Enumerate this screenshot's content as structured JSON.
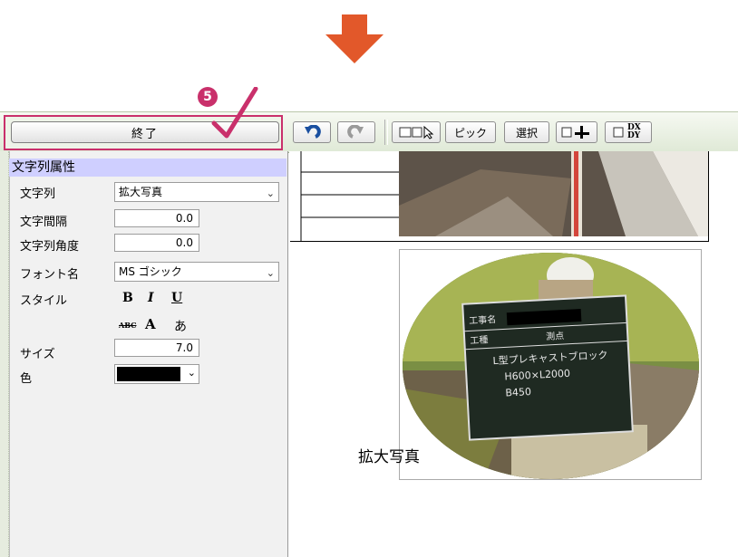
{
  "step": {
    "number": "5"
  },
  "end_button": {
    "label": "終了"
  },
  "toolbar": {
    "pick_label": "ピック",
    "select_label": "選択",
    "dxdy_label": "DX DY"
  },
  "panel": {
    "header": "文字列属性",
    "rows": [
      {
        "label": "文字列",
        "value": "拡大写真"
      },
      {
        "label": "文字間隔",
        "value": "0.0"
      },
      {
        "label": "文字列角度",
        "value": "0.0"
      },
      {
        "label": "フォント名",
        "value": "MS ゴシック"
      },
      {
        "label": "スタイル"
      },
      {
        "label": "サイズ",
        "value": "7.0"
      },
      {
        "label": "色"
      }
    ],
    "style_buttons": {
      "bold": "B",
      "italic": "I",
      "underline": "U",
      "strike": "ABC",
      "a_plus": "A",
      "hiragana": "あ"
    }
  },
  "canvas": {
    "caption": "拡大写真"
  },
  "colors": {
    "accent": "#c9306b",
    "arrow": "#e2582a",
    "header_bg": "#cfcfff",
    "selected_color": "#000000"
  },
  "board": {
    "title_label": "工事名",
    "work_label": "工種",
    "survey_label": "測点",
    "note_lines": [
      "L型プレキャストブロック",
      "H600×L2000",
      "B450"
    ]
  }
}
